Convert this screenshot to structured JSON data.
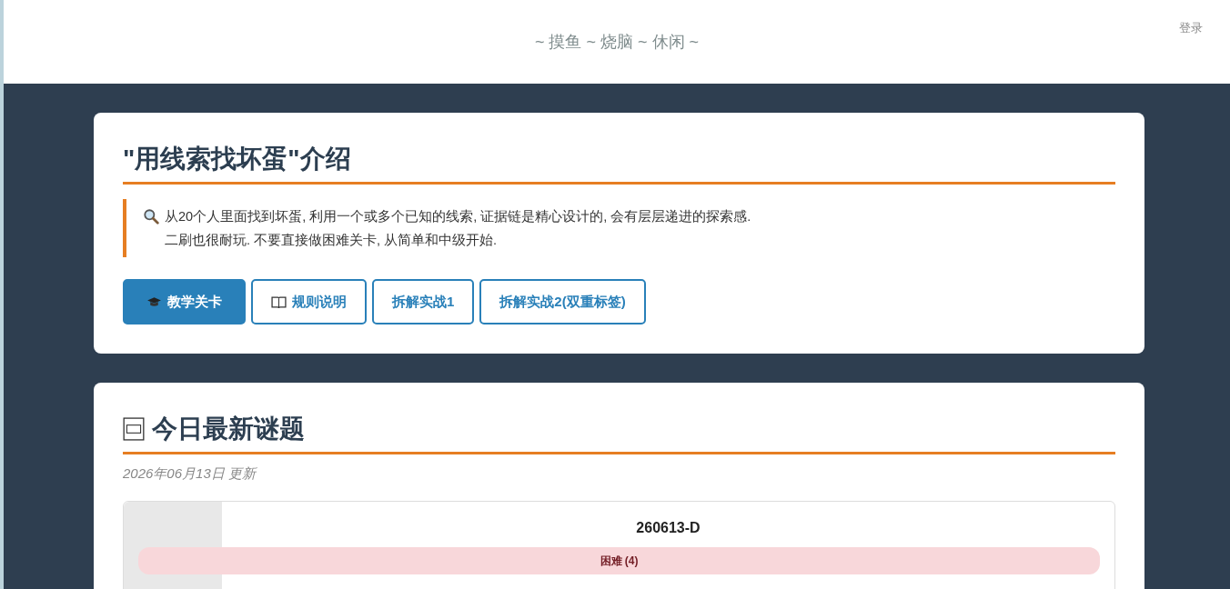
{
  "header": {
    "tagline": "~ 摸鱼 ~ 烧脑 ~ 休闲 ~",
    "login": "登录"
  },
  "intro": {
    "title": "\"用线索找坏蛋\"介绍",
    "text": "从20个人里面找到坏蛋, 利用一个或多个已知的线索, 证据链是精心设计的, 会有层层递进的探索感. 二刷也很耐玩. 不要直接做困难关卡, 从简单和中级开始.",
    "buttons": [
      {
        "label": "教学关卡",
        "kind": "cap",
        "selected": true
      },
      {
        "label": "规则说明",
        "kind": "book",
        "selected": false
      },
      {
        "label": "拆解实战1",
        "kind": "plain",
        "selected": false
      },
      {
        "label": "拆解实战2(双重标签)",
        "kind": "plain",
        "selected": false
      }
    ]
  },
  "latest": {
    "title": "今日最新谜题",
    "updated": "2026年06月13日 更新",
    "puzzles": [
      {
        "code": "260613-D",
        "difficulty": {
          "label": "困难 (4)",
          "kind": "hard"
        }
      }
    ]
  }
}
